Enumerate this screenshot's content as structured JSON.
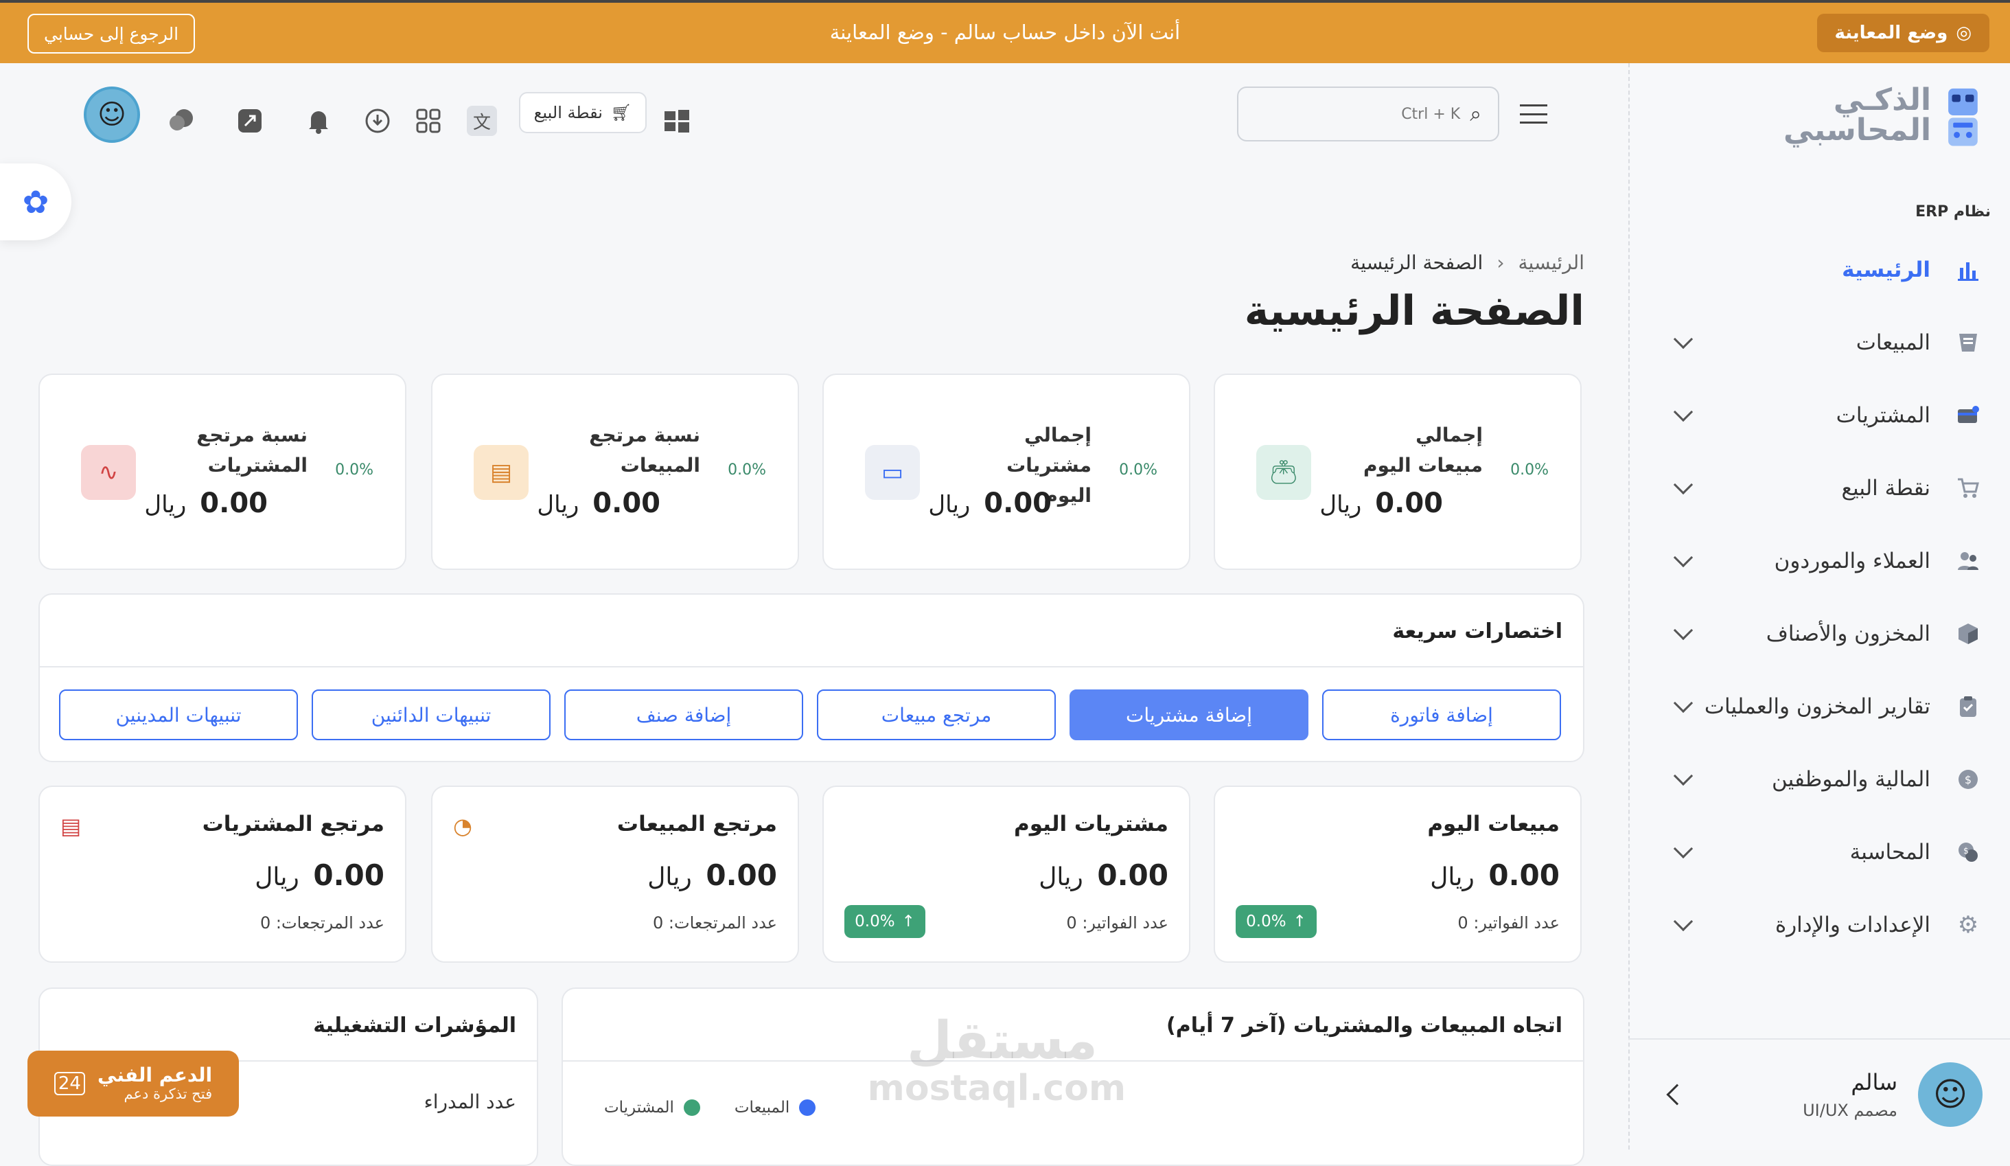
{
  "topbar": {
    "preview_label": "وضع المعاينة",
    "message": "أنت الآن داخل حساب سالم - وضع المعاينة",
    "back_label": "الرجوع إلى حسابي"
  },
  "logo": {
    "line1": "الذكـي",
    "line2": "المحاسبي"
  },
  "sidebar": {
    "section_label": "نظام ERP",
    "items": [
      {
        "label": "الرئيسية",
        "icon": "bar-chart-icon",
        "active": true
      },
      {
        "label": "المبيعات",
        "icon": "invoice-icon"
      },
      {
        "label": "المشتريات",
        "icon": "card-icon"
      },
      {
        "label": "نقطة البيع",
        "icon": "cart-icon"
      },
      {
        "label": "العملاء والموردون",
        "icon": "users-icon"
      },
      {
        "label": "المخزون والأصناف",
        "icon": "box-icon"
      },
      {
        "label": "تقارير المخزون والعمليات",
        "icon": "clipboard-icon"
      },
      {
        "label": "المالية والموظفين",
        "icon": "money-icon"
      },
      {
        "label": "المحاسبة",
        "icon": "coins-icon"
      },
      {
        "label": "الإعدادات والإدارة",
        "icon": "gear-icon"
      }
    ],
    "user": {
      "name": "سالم",
      "role": "مصمم UI/UX"
    }
  },
  "header": {
    "search_placeholder": "Ctrl + K",
    "pos_label": "نقطة البيع"
  },
  "breadcrumb": {
    "home": "الرئيسية",
    "current": "الصفحة الرئيسية"
  },
  "page_title": "الصفحة الرئيسية",
  "stats": [
    {
      "title": "إجمالي مبيعات اليوم",
      "value": "0.00",
      "currency": "ريال",
      "pct": "0.0%",
      "icon": "wallet-icon",
      "color": "#dff1ea"
    },
    {
      "title": "إجمالي مشتريات اليوم",
      "value": "0.00",
      "currency": "ريال",
      "pct": "0.0%",
      "icon": "card-icon",
      "color": "#eceff5"
    },
    {
      "title": "نسبة مرتجع المبيعات",
      "value": "0.00",
      "currency": "ريال",
      "pct": "0.0%",
      "icon": "receipt-icon",
      "color": "#fbe7cc"
    },
    {
      "title": "نسبة مرتجع المشتريات",
      "value": "0.00",
      "currency": "ريال",
      "pct": "0.0%",
      "icon": "chart-line-icon",
      "color": "#f8d5d5"
    }
  ],
  "shortcuts": {
    "title": "اختصارات سريعة",
    "buttons": [
      "إضافة فاتورة",
      "إضافة مشتريات",
      "مرتجع مبيعات",
      "إضافة صنف",
      "تنبيهات الدائنين",
      "تنبيهات المدينين"
    ]
  },
  "daily": [
    {
      "title": "مبيعات اليوم",
      "value": "0.00",
      "currency": "ريال",
      "sub": "عدد الفواتير: 0",
      "badge": "0.0%"
    },
    {
      "title": "مشتريات اليوم",
      "value": "0.00",
      "currency": "ريال",
      "sub": "عدد الفواتير: 0",
      "badge": "0.0%"
    },
    {
      "title": "مرتجع المبيعات",
      "value": "0.00",
      "currency": "ريال",
      "sub": "عدد المرتجعات: 0"
    },
    {
      "title": "مرتجع المشتريات",
      "value": "0.00",
      "currency": "ريال",
      "sub": "عدد المرتجعات: 0"
    }
  ],
  "trend_panel": {
    "title": "اتجاه المبيعات والمشتريات (آخر 7 أيام)",
    "legend_purchases": "المشتريات",
    "legend_sales": "المبيعات",
    "color_purchases": "#3ea277",
    "color_sales": "#3b6ef3"
  },
  "kpi_panel": {
    "title": "المؤشرات التشغيلية",
    "row1": "عدد المدراء"
  },
  "support": {
    "title": "الدعم الفني",
    "subtitle": "فتح تذكرة دعم"
  },
  "watermark": {
    "line1": "مستقل",
    "line2": "mostaql.com"
  }
}
